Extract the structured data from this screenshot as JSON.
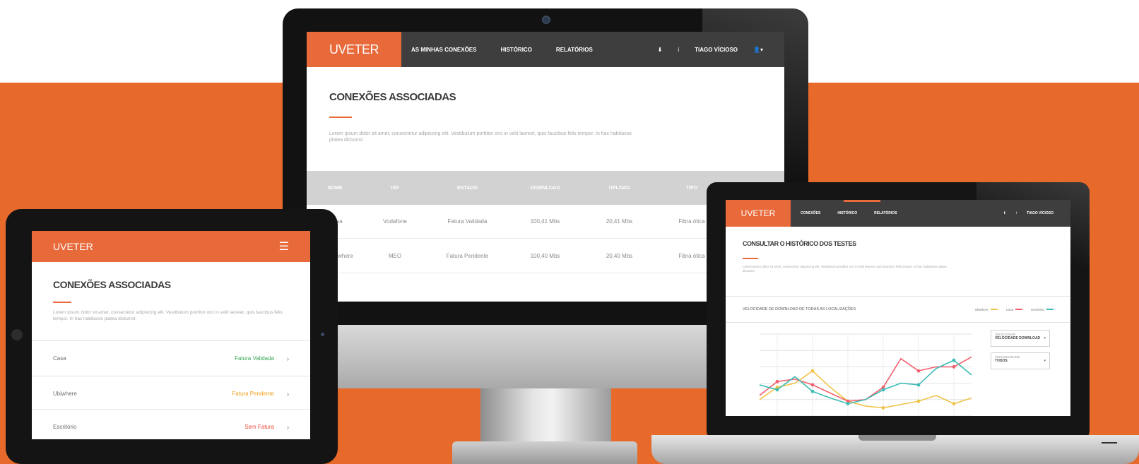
{
  "colors": {
    "orange": "#e86a2b",
    "accent": "#e8693a",
    "navbar": "#3e3e3e",
    "status_green": "#3aa657",
    "status_orange": "#f0a11d",
    "status_red": "#e84e3a"
  },
  "desktop": {
    "logo": "UVETER",
    "menu": [
      "AS MINHAS CONEXÕES",
      "HISTÓRICO",
      "RELATÓRIOS"
    ],
    "nav_icons": [
      "download-icon",
      "info-icon"
    ],
    "user_name": "TIAGO VÍCIOSO",
    "page_title": "CONEXÕES ASSOCIADAS",
    "description": "Lorem ipsum dolor sit amet, consectetur adipiscing elit. Vestibulum porttitor orci in velit laoreet, quis faucibus felis tempor. In hac habitasse platea dictumst.",
    "table": {
      "columns": [
        "NOME",
        "ISP",
        "ESTADO",
        "DOWNLOAD",
        "UPLOAD",
        "TIPO"
      ],
      "rows": [
        {
          "name": "Casa",
          "isp": "Vodafone",
          "status": "Fatura Validada",
          "status_type": "green",
          "download": "100,41 Mbs",
          "upload": "20,41 Mbs",
          "type": "Fibra ótica"
        },
        {
          "name": "Ubiwhere",
          "isp": "MEO",
          "status": "Fatura Pendente",
          "status_type": "orange",
          "download": "100,40 Mbs",
          "upload": "20,40 Mbs",
          "type": "Fibra ótica"
        }
      ]
    }
  },
  "tablet": {
    "logo": "UVETER",
    "page_title": "CONEXÕES ASSOCIADAS",
    "description": "Lorem ipsum dolor sit amet, consectetur adipiscing elit. Vestibulum porttitor orci in velit laoreet, quis faucibus felis tempor. In hac habitasse platea dictumst.",
    "items": [
      {
        "name": "Casa",
        "status": "Fatura Validada",
        "status_type": "green"
      },
      {
        "name": "Ubiwhere",
        "status": "Fatura Pendente",
        "status_type": "orange"
      },
      {
        "name": "Escritório",
        "status": "Sem Fatura",
        "status_type": "red"
      }
    ]
  },
  "laptop": {
    "logo": "UVETER",
    "menu": [
      "CONEXÕES",
      "HISTÓRICO",
      "RELATÓRIOS"
    ],
    "user_name": "TIAGO VÍCIOSO",
    "page_title": "CONSULTAR O HISTÓRICO DOS TESTES",
    "description": "Lorem ipsum dolor sit amet, consectetur adipiscing elit. Vestibulum porttitor orci in velit laoreet, quis faucibus felis tempor. In hac habitasse platea dictumst.",
    "chart_title": "VELOCIDADE DE DOWNLOAD DE TODAS AS LOCALIZAÇÕES",
    "selects": [
      {
        "label": "SELECIONAR",
        "value": "VELOCIDADE DOWNLOAD"
      },
      {
        "label": "PERIODICIDADE",
        "value": "TODOS"
      }
    ]
  },
  "chart_data": {
    "type": "line",
    "title": "VELOCIDADE DE DOWNLOAD DE TODAS AS LOCALIZAÇÕES",
    "x": [
      1,
      2,
      3,
      4,
      5,
      6,
      7,
      8,
      9,
      10,
      11,
      12,
      13
    ],
    "ylim": [
      0,
      100
    ],
    "grid": true,
    "legend_position": "top-right",
    "series": [
      {
        "name": "Ubiwhere",
        "color": "#f0c44a",
        "values": [
          20,
          35,
          40,
          55,
          35,
          18,
          12,
          10,
          14,
          18,
          25,
          15,
          22
        ]
      },
      {
        "name": "Casa",
        "color": "#f2606e",
        "values": [
          25,
          42,
          45,
          38,
          28,
          18,
          20,
          35,
          70,
          55,
          60,
          60,
          72
        ]
      },
      {
        "name": "Escritório",
        "color": "#3cbcb4",
        "values": [
          38,
          32,
          48,
          30,
          22,
          15,
          20,
          32,
          40,
          38,
          58,
          68,
          50
        ]
      }
    ]
  }
}
